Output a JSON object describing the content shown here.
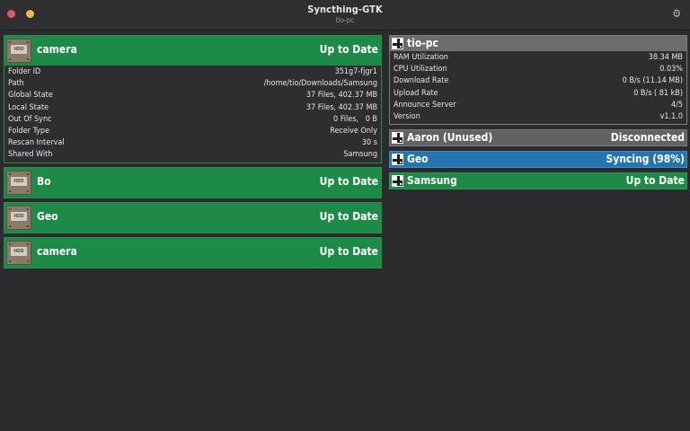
{
  "window": {
    "title": "Syncthing-GTK",
    "subtitle": "tio-pc",
    "settings_icon": "gear-icon"
  },
  "colors": {
    "uptodate": "#1e8a47",
    "syncing": "#2474b0",
    "disconnected": "#626264",
    "local_device": "#6d6d6f",
    "background": "#2b2b2d"
  },
  "folders": [
    {
      "name": "camera",
      "status": "Up to Date",
      "icon": "hdd-icon",
      "details": [
        {
          "label": "Folder ID",
          "value": "351g7-fjgr1"
        },
        {
          "label": "Path",
          "value": "/home/tio/Downloads/Samsung"
        },
        {
          "label": "Global State",
          "value": "37 Files, 402.37 MB"
        },
        {
          "label": "Local State",
          "value": "37 Files, 402.37 MB"
        },
        {
          "label": "Out Of Sync",
          "value": "0 Files,   0 B"
        },
        {
          "label": "Folder Type",
          "value": "Receive Only"
        },
        {
          "label": "Rescan Interval",
          "value": "30 s"
        },
        {
          "label": "Shared With",
          "value": "Samsung"
        }
      ]
    },
    {
      "name": "Bo",
      "status": "Up to Date",
      "icon": "hdd-icon"
    },
    {
      "name": "Geo",
      "status": "Up to Date",
      "icon": "hdd-icon"
    },
    {
      "name": "camera",
      "status": "Up to Date",
      "icon": "hdd-icon"
    }
  ],
  "local_device": {
    "name": "tio-pc",
    "icon": "qr-identicon",
    "details": [
      {
        "label": "RAM Utilization",
        "value": "38.34 MB"
      },
      {
        "label": "CPU Utilization",
        "value": "0.03%"
      },
      {
        "label": "Download Rate",
        "value": "0 B/s (11.14 MB)"
      },
      {
        "label": "Upload Rate",
        "value": "0 B/s ( 81 kB)"
      },
      {
        "label": "Announce Server",
        "value": "4/5"
      },
      {
        "label": "Version",
        "value": "v1.1.0"
      }
    ]
  },
  "devices": [
    {
      "name": "Aaron (Unused)",
      "status": "Disconnected",
      "icon": "qr-identicon"
    },
    {
      "name": "Geo",
      "status": "Syncing (98%)",
      "icon": "qr-identicon"
    },
    {
      "name": "Samsung",
      "status": "Up to Date",
      "icon": "qr-identicon"
    }
  ]
}
